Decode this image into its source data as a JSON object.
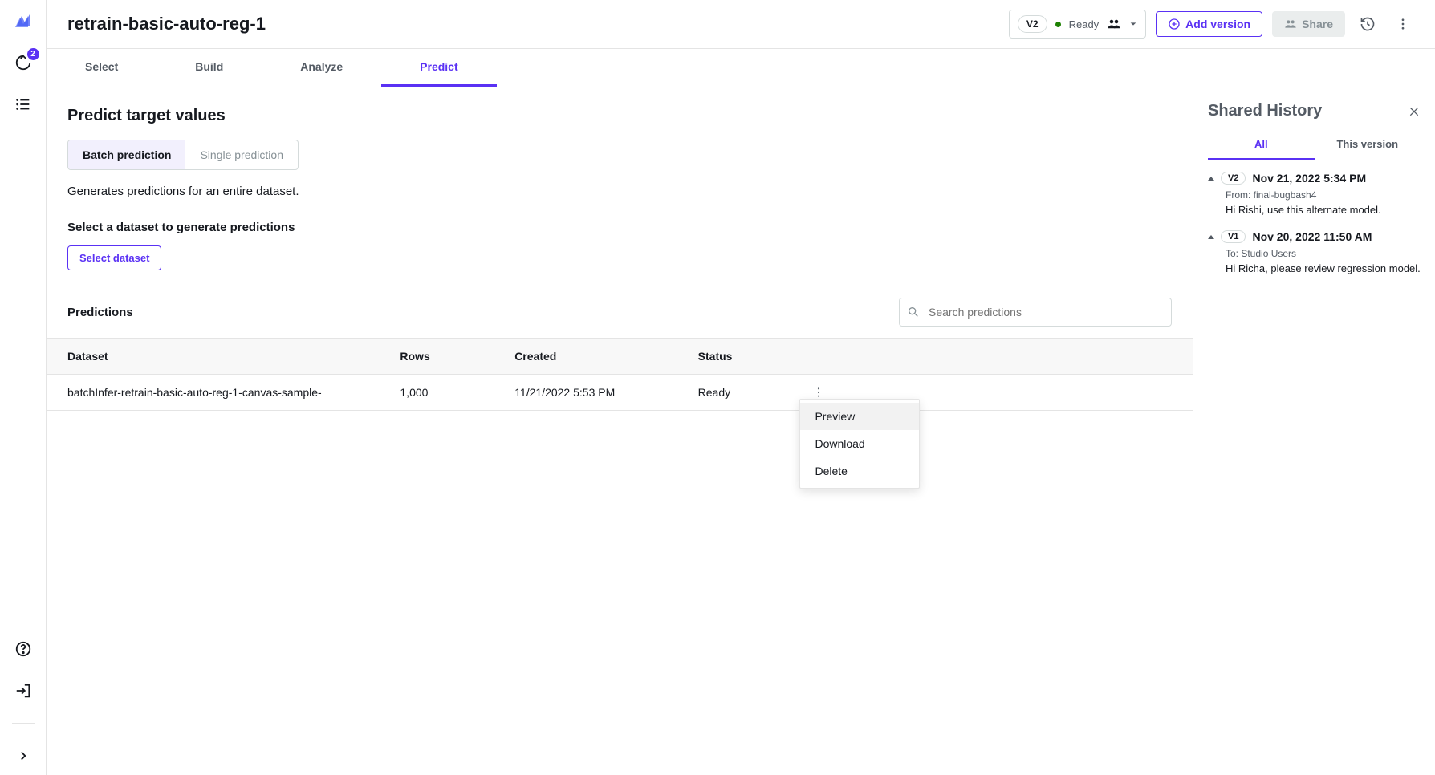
{
  "rail": {
    "badge": "2"
  },
  "header": {
    "title": "retrain-basic-auto-reg-1",
    "version": "V2",
    "status": "Ready",
    "add_version": "Add version",
    "share": "Share"
  },
  "tabs": {
    "select": "Select",
    "build": "Build",
    "analyze": "Analyze",
    "predict": "Predict"
  },
  "predict": {
    "heading": "Predict target values",
    "batch": "Batch prediction",
    "single": "Single prediction",
    "desc": "Generates predictions for an entire dataset.",
    "select_ds_label": "Select a dataset to generate predictions",
    "select_ds_btn": "Select dataset",
    "predictions_label": "Predictions",
    "search_placeholder": "Search predictions",
    "cols": {
      "dataset": "Dataset",
      "rows": "Rows",
      "created": "Created",
      "status": "Status"
    },
    "row0": {
      "dataset": "batchInfer-retrain-basic-auto-reg-1-canvas-sample-",
      "rows": "1,000",
      "created": "11/21/2022 5:53 PM",
      "status": "Ready"
    },
    "menu": {
      "preview": "Preview",
      "download": "Download",
      "delete": "Delete"
    }
  },
  "panel": {
    "title": "Shared History",
    "tab_all": "All",
    "tab_this": "This version",
    "items": [
      {
        "ver": "V2",
        "date": "Nov 21, 2022 5:34 PM",
        "meta": "From: final-bugbash4",
        "msg": "Hi Rishi, use this alternate model."
      },
      {
        "ver": "V1",
        "date": "Nov 20, 2022 11:50 AM",
        "meta": "To: Studio Users",
        "msg": "Hi Richa, please review regression model."
      }
    ]
  }
}
